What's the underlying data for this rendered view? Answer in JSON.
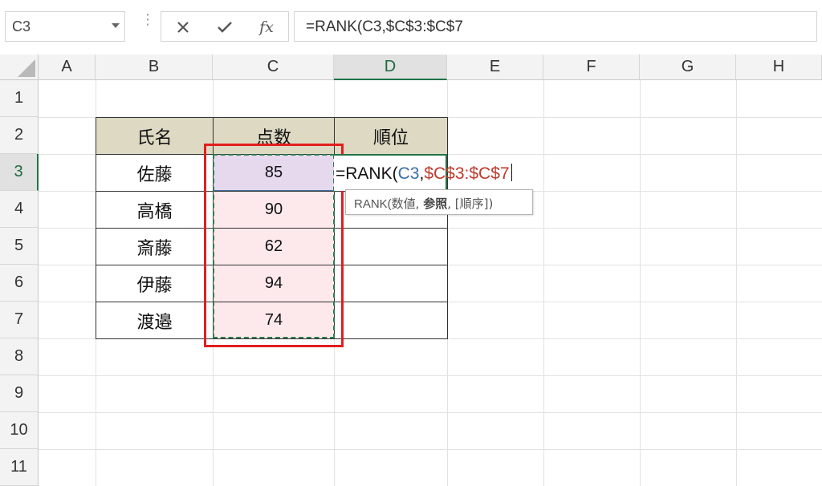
{
  "name_box": {
    "value": "C3"
  },
  "formula_bar": {
    "cancel_icon": "x-icon",
    "enter_icon": "check-icon",
    "fx_label": "fx",
    "formula": "=RANK(C3,$C$3:$C$7"
  },
  "columns": [
    "A",
    "B",
    "C",
    "D",
    "E",
    "F",
    "G",
    "H"
  ],
  "rows": [
    "1",
    "2",
    "3",
    "4",
    "5",
    "6",
    "7",
    "8",
    "9",
    "10",
    "11"
  ],
  "table": {
    "headers": [
      "氏名",
      "点数",
      "順位"
    ],
    "rows": [
      {
        "name": "佐藤",
        "score": "85"
      },
      {
        "name": "高橋",
        "score": "90"
      },
      {
        "name": "斎藤",
        "score": "62"
      },
      {
        "name": "伊藤",
        "score": "94"
      },
      {
        "name": "渡邉",
        "score": "74"
      }
    ]
  },
  "editing_cell": {
    "prefix": "=RANK(",
    "ref1": "C3",
    "comma": ",",
    "ref2": "$C$3:$C$7",
    "ref1_color": "#3a6ea5",
    "ref2_color": "#c0392b"
  },
  "tooltip": {
    "func": "RANK(",
    "arg1": "数値, ",
    "arg2": "参照",
    "arg3": ", [順序])"
  },
  "highlight_color": "#e21e1e",
  "selection_color": "#217346"
}
